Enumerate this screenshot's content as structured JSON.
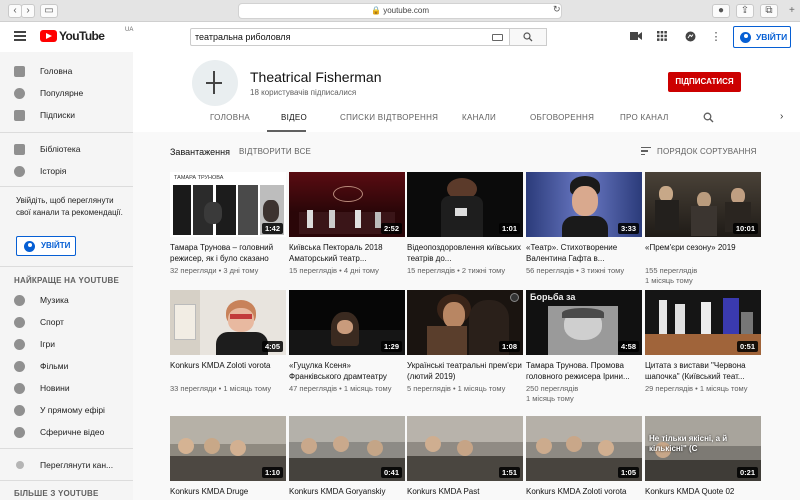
{
  "browser": {
    "url": "youtube.com"
  },
  "masthead": {
    "logo_text": "YouTube",
    "logo_region": "UA",
    "search_value": "театральна риболовля",
    "signin_label": "УВІЙТИ"
  },
  "sidebar": {
    "main": [
      {
        "label": "Головна",
        "icon": "home-icon"
      },
      {
        "label": "Популярне",
        "icon": "flame-icon"
      },
      {
        "label": "Підписки",
        "icon": "subscriptions-icon"
      }
    ],
    "library": [
      {
        "label": "Бібліотека",
        "icon": "folder-icon"
      },
      {
        "label": "Історія",
        "icon": "history-icon"
      }
    ],
    "signin_note": "Увійдіть, щоб переглянути свої канали та рекомендації.",
    "signin_label": "УВІЙТИ",
    "best_heading": "НАЙКРАЩЕ НА YOUTUBE",
    "best": [
      {
        "label": "Музика",
        "icon": "music-icon"
      },
      {
        "label": "Спорт",
        "icon": "sport-icon"
      },
      {
        "label": "Ігри",
        "icon": "games-icon"
      },
      {
        "label": "Фільми",
        "icon": "movies-icon"
      },
      {
        "label": "Новини",
        "icon": "news-icon"
      },
      {
        "label": "У прямому ефірі",
        "icon": "live-icon"
      },
      {
        "label": "Сферичне відео",
        "icon": "360-icon"
      }
    ],
    "browse_channels": "Переглянути кан...",
    "more_heading": "БІЛЬШЕ З YOUTUBE"
  },
  "channel": {
    "name": "Theatrical Fisherman",
    "subscribers": "18 користувачів підписалися",
    "subscribe_label": "ПІДПИСАТИСЯ",
    "tabs": [
      "ГОЛОВНА",
      "ВІДЕО",
      "СПИСКИ ВІДТВОРЕННЯ",
      "КАНАЛИ",
      "ОБГОВОРЕННЯ",
      "ПРО КАНАЛ"
    ],
    "active_tab": "ВІДЕО"
  },
  "uploads": {
    "title": "Завантаження",
    "play_all": "ВІДТВОРИТИ ВСЕ",
    "sort_label": "ПОРЯДОК СОРТУВАННЯ"
  },
  "videos": [
    {
      "title": "Тамара Трунова – головний режисер, як і було сказано",
      "views": "32 перегляди",
      "age": "3 дні тому",
      "duration": "1:42"
    },
    {
      "title": "Київська Пектораль 2018 Аматорський театр...",
      "views": "15 переглядів",
      "age": "4 дні тому",
      "duration": "2:52"
    },
    {
      "title": "Відеопоздоровлення київських театрів до...",
      "views": "15 переглядів",
      "age": "2 тижні тому",
      "duration": "1:01"
    },
    {
      "title": "«Театр». Стихотворение Валентина Гафта в...",
      "views": "56 переглядів",
      "age": "3 тижні тому",
      "duration": "3:33"
    },
    {
      "title": "«Прем'єри сезону» 2019",
      "views": "155 переглядів",
      "age": "1 місяць тому",
      "duration": "10:01"
    },
    {
      "title": "Konkurs KMDA Zoloti vorota",
      "views": "33 перегляди",
      "age": "1 місяць тому",
      "duration": "4:05"
    },
    {
      "title": "«Гуцулка Ксеня» Франківського драмтеатру",
      "views": "47 переглядів",
      "age": "1 місяць тому",
      "duration": "1:29"
    },
    {
      "title": "Українські театральні прем'єри (лютий 2019)",
      "views": "5 переглядів",
      "age": "1 місяць тому",
      "duration": "1:08"
    },
    {
      "title": "Тамара Трунова. Промова головного режисера Ірини...",
      "views": "250 переглядів",
      "age": "1 місяць тому",
      "duration": "4:58"
    },
    {
      "title": "Цитата з вистави \"Червона шапочка\" (Київський теат...",
      "views": "29 переглядів",
      "age": "1 місяць тому",
      "duration": "0:51"
    },
    {
      "title": "Konkurs KMDA Druge",
      "views": "",
      "age": "",
      "duration": "1:10"
    },
    {
      "title": "Konkurs KMDA Goryanskiy",
      "views": "",
      "age": "",
      "duration": "0:41"
    },
    {
      "title": "Konkurs KMDA Past",
      "views": "",
      "age": "",
      "duration": "1:51"
    },
    {
      "title": "Konkurs KMDA Zoloti vorota",
      "views": "",
      "age": "",
      "duration": "1:05"
    },
    {
      "title": "Konkurs KMDA Quote 02",
      "views": "",
      "age": "",
      "duration": "0:21"
    }
  ],
  "thumb_overlays": {
    "v0_header": "ТАМАРА ТРУНОВА",
    "v8_caption": "Борьба за",
    "v14_caption": "Не тільки якісні, а й кількісні\" (С"
  },
  "colors": {
    "brand_red": "#ff0000",
    "subscribe_red": "#cc0000",
    "link_blue": "#065fd4",
    "sidebar_bg": "#f5f5f5"
  }
}
